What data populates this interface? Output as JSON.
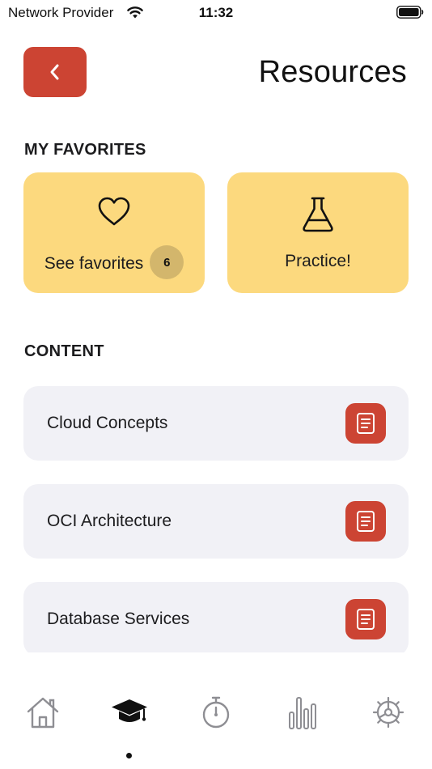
{
  "status_bar": {
    "carrier": "Network Provider",
    "time": "11:32",
    "wifi_icon": "wifi-icon",
    "battery_icon": "battery-icon"
  },
  "header": {
    "back_icon": "chevron-left-icon",
    "title": "Resources"
  },
  "favorites": {
    "section_label": "MY FAVORITES",
    "cards": [
      {
        "icon": "heart-icon",
        "label": "See favorites",
        "badge": "6"
      },
      {
        "icon": "flask-icon",
        "label": "Practice!"
      }
    ]
  },
  "content": {
    "section_label": "CONTENT",
    "items": [
      {
        "label": "Cloud Concepts",
        "icon": "document-icon"
      },
      {
        "label": "OCI Architecture",
        "icon": "document-icon"
      },
      {
        "label": "Database Services",
        "icon": "document-icon"
      }
    ]
  },
  "tab_bar": {
    "tabs": [
      {
        "icon": "home-icon",
        "active": false
      },
      {
        "icon": "graduation-cap-icon",
        "active": true
      },
      {
        "icon": "stopwatch-icon",
        "active": false
      },
      {
        "icon": "bar-chart-icon",
        "active": false
      },
      {
        "icon": "gear-icon",
        "active": false
      }
    ]
  },
  "colors": {
    "accent": "#cc4433",
    "card_yellow": "#fcd97e",
    "badge_bg": "#d3b66c",
    "list_bg": "#f1f1f6",
    "tab_inactive": "#8e8e93",
    "tab_active": "#111111"
  }
}
